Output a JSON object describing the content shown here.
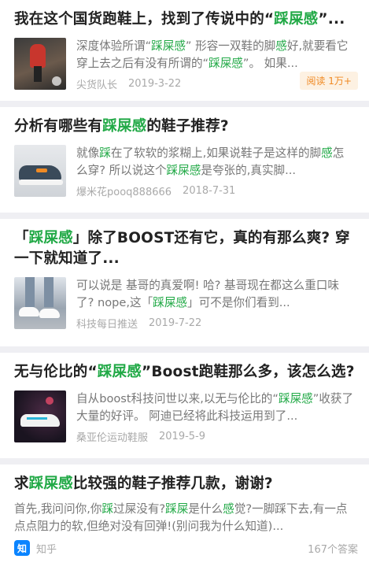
{
  "feed": [
    {
      "title": [
        {
          "t": "我在这个国货跑鞋上，找到了传说中的“"
        },
        {
          "t": "踩屎感",
          "h": true
        },
        {
          "t": "”..."
        }
      ],
      "snippet": [
        {
          "t": "深度体验所谓“"
        },
        {
          "t": "踩屎感",
          "h": true
        },
        {
          "t": "” 形容一双鞋的脚"
        },
        {
          "t": "感",
          "h": true
        },
        {
          "t": "好,就要看它穿上去之后有没有所谓的“"
        },
        {
          "t": "踩屎感",
          "h": true
        },
        {
          "t": "”。 如果..."
        }
      ],
      "source": "尖货队长",
      "date": "2019-3-22",
      "badge": "阅读 1万+"
    },
    {
      "title": [
        {
          "t": "分析有哪些有"
        },
        {
          "t": "踩屎感",
          "h": true
        },
        {
          "t": "的鞋子推荐?"
        }
      ],
      "snippet": [
        {
          "t": "就像"
        },
        {
          "t": "踩",
          "h": true
        },
        {
          "t": "在了软软的浆糊上,如果说鞋子是这样的脚"
        },
        {
          "t": "感",
          "h": true
        },
        {
          "t": "怎么穿? 所以说这个"
        },
        {
          "t": "踩屎感",
          "h": true
        },
        {
          "t": "是夸张的,真实脚..."
        }
      ],
      "source": "爆米花pooq888666",
      "date": "2018-7-31"
    },
    {
      "title": [
        {
          "t": "「"
        },
        {
          "t": "踩屎感",
          "h": true
        },
        {
          "t": "」除了BOOST还有它，真的有那么爽? 穿一下就知道了..."
        }
      ],
      "snippet": [
        {
          "t": "可以说是 基哥的真爱啊! 哈? 基哥现在都这么重口味了? nope,这「"
        },
        {
          "t": "踩屎感",
          "h": true
        },
        {
          "t": "」可不是你们看到..."
        }
      ],
      "source": "科技每日推送",
      "date": "2019-7-22"
    },
    {
      "title": [
        {
          "t": "无与伦比的“"
        },
        {
          "t": "踩屎感",
          "h": true
        },
        {
          "t": "”Boost跑鞋那么多，该怎么选?"
        }
      ],
      "snippet": [
        {
          "t": "自从boost科技问世以来,以无与伦比的“"
        },
        {
          "t": "踩屎感",
          "h": true
        },
        {
          "t": "”收获了大量的好评。 阿迪已经将此科技运用到了..."
        }
      ],
      "source": "桑亚伦运动鞋服",
      "date": "2019-5-9"
    },
    {
      "title": [
        {
          "t": "求"
        },
        {
          "t": "踩屎感",
          "h": true
        },
        {
          "t": "比较强的鞋子推荐几款，谢谢?"
        }
      ],
      "snippet": [
        {
          "t": "首先,我问问你,你"
        },
        {
          "t": "踩",
          "h": true
        },
        {
          "t": "过屎没有?"
        },
        {
          "t": "踩屎",
          "h": true
        },
        {
          "t": "是什么"
        },
        {
          "t": "感",
          "h": true
        },
        {
          "t": "觉?一脚踩下去,有一点点点阻力的软,但绝对没有回弹!(别问我为什么知道)..."
        }
      ],
      "logo_text": "知",
      "source": "知乎",
      "answers": "167个答案"
    }
  ],
  "colors": {
    "highlight": "#21a946",
    "badge_text": "#f08a24",
    "separator": "#efeff3",
    "zhihu_blue": "#0a84ff"
  }
}
